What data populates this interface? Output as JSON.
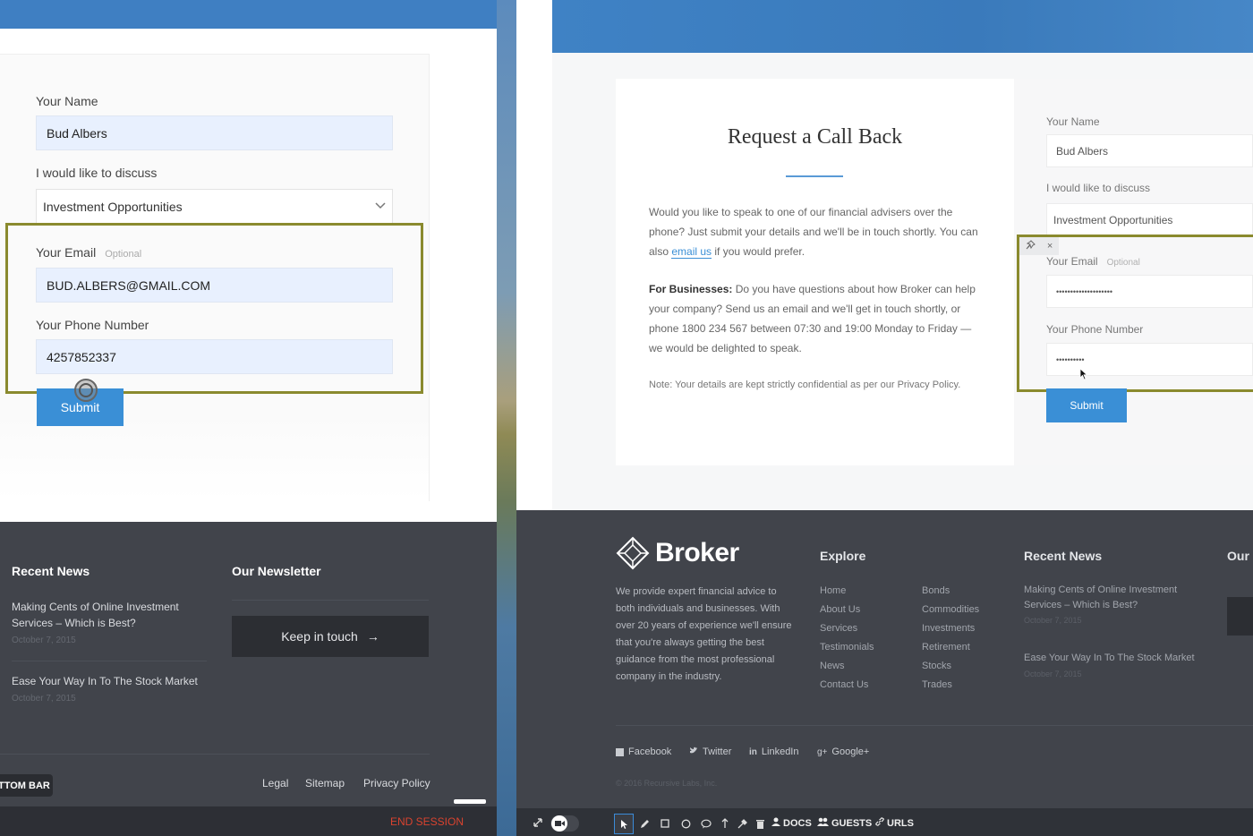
{
  "left": {
    "form": {
      "name_label": "Your Name",
      "name_value": "Bud Albers",
      "discuss_label": "I would like to discuss",
      "discuss_value": "Investment Opportunities",
      "email_label": "Your Email",
      "email_optional": "Optional",
      "email_value": "BUD.ALBERS@GMAIL.COM",
      "phone_label": "Your Phone Number",
      "phone_value": "4257852337",
      "submit_label": "Submit"
    },
    "footer": {
      "recent_news_heading": "Recent News",
      "news": [
        {
          "title": "Making Cents of Online Investment Services – Which is Best?",
          "date": "October 7, 2015"
        },
        {
          "title": "Ease Your Way In To The Stock Market",
          "date": "October 7, 2015"
        }
      ],
      "newsletter_heading": "Our Newsletter",
      "newsletter_button": "Keep in touch",
      "newsletter_arrow": "→",
      "links": [
        "Legal",
        "Sitemap",
        "Privacy Policy"
      ],
      "bottom_bar_label": "TTOM BAR",
      "end_session": "END SESSION"
    }
  },
  "right": {
    "callback": {
      "title": "Request a Call Back",
      "intro_part1": "Would you like to speak to one of our financial advisers over the phone? Just submit your details and we'll be in touch shortly. You can also ",
      "intro_link": "email us",
      "intro_part2": " if you would prefer.",
      "business_bold": "For Businesses:",
      "business_text": " Do you have questions about how Broker can help your company? Send us an email and we'll get in touch shortly, or phone 1800 234 567 between 07:30 and 19:00 Monday to Friday — we would be delighted to speak.",
      "note": "Note: Your details are kept strictly confidential as per our Privacy Policy."
    },
    "form": {
      "name_label": "Your Name",
      "name_value": "Bud Albers",
      "discuss_label": "I would like to discuss",
      "discuss_value": "Investment Opportunities",
      "email_label": "Your Email",
      "email_optional": "Optional",
      "email_value": "••••••••••••••••••••",
      "phone_label": "Your Phone Number",
      "phone_value": "••••••••••",
      "submit_label": "Submit",
      "pin_icon": "📌",
      "close_icon": "×"
    },
    "footer": {
      "brand": "Broker",
      "about": "We provide expert financial advice to both individuals and businesses. With over 20 years of experience we'll ensure that you're always getting the best guidance from the most professional company in the industry.",
      "explore_heading": "Explore",
      "explore_col1": [
        "Home",
        "About Us",
        "Services",
        "Testimonials",
        "News",
        "Contact Us"
      ],
      "explore_col2": [
        "Bonds",
        "Commodities",
        "Investments",
        "Retirement",
        "Stocks",
        "Trades"
      ],
      "recent_news_heading": "Recent News",
      "news": [
        {
          "title": "Making Cents of Online Investment Services – Which is Best?",
          "date": "October 7, 2015"
        },
        {
          "title": "Ease Your Way In To The Stock Market",
          "date": "October 7, 2015"
        }
      ],
      "our_heading_partial": "Our N",
      "social": [
        {
          "icon": "facebook-icon",
          "label": "Facebook"
        },
        {
          "icon": "twitter-icon",
          "label": "Twitter"
        },
        {
          "icon": "linkedin-icon",
          "label": "LinkedIn"
        },
        {
          "icon": "googleplus-icon",
          "label": "Google+"
        }
      ],
      "copyright": "© 2016 Recursive Labs, Inc."
    },
    "toolbar": {
      "docs": "DOCS",
      "guests": "GUESTS",
      "urls": "URLS"
    }
  },
  "colors": {
    "accent": "#3a8fd6",
    "footer_bg": "#41444b",
    "highlight": "#8a8a2e",
    "end_session": "#d9432f"
  }
}
